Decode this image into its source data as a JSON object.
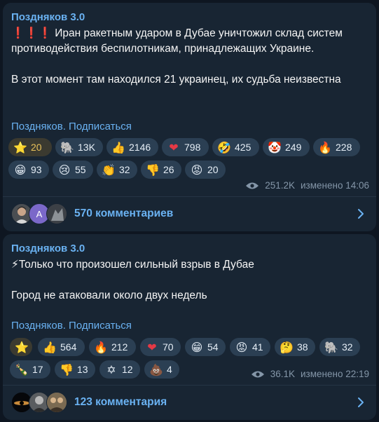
{
  "posts": [
    {
      "channel": "Поздняков 3.0",
      "text": "❗❗❗ Иран ракетным ударом в Дубае уничтожил склад систем противодействия беспилотникам, принадлежащих Украине.\n\nВ этот момент там находился 21 украинец, их судьба неизвестна",
      "subscribe": "Поздняков. Подписаться",
      "reactions": [
        {
          "icon": "star-icon",
          "emoji": "⭐",
          "count": "20"
        },
        {
          "icon": "elephant-icon",
          "emoji": "🐘",
          "count": "13K"
        },
        {
          "icon": "thumbs-up-icon",
          "emoji": "👍",
          "count": "2146"
        },
        {
          "icon": "heart-icon",
          "emoji": "❤",
          "count": "798"
        },
        {
          "icon": "rofl-icon",
          "emoji": "🤣",
          "count": "425"
        },
        {
          "icon": "clown-icon",
          "emoji": "🤡",
          "count": "249"
        },
        {
          "icon": "fire-icon",
          "emoji": "🔥",
          "count": "228"
        },
        {
          "icon": "grin-icon",
          "emoji": "😁",
          "count": "93"
        },
        {
          "icon": "cry-icon",
          "emoji": "😢",
          "count": "55"
        },
        {
          "icon": "clap-icon",
          "emoji": "👏",
          "count": "32"
        },
        {
          "icon": "thumbs-down-icon",
          "emoji": "👎",
          "count": "26"
        },
        {
          "icon": "angry-icon",
          "emoji": "😡",
          "count": "20"
        }
      ],
      "views": "251.2K",
      "edited": "изменено 14:06",
      "comments_label": "570 комментариев",
      "avatar_letter": "A"
    },
    {
      "channel": "Поздняков 3.0",
      "text": "⚡Только что произошел сильный взрыв в Дубае\n\nГород не атаковали около двух недель",
      "subscribe": "Поздняков. Подписаться",
      "reactions": [
        {
          "icon": "star-icon",
          "emoji": "⭐",
          "count": ""
        },
        {
          "icon": "thumbs-up-icon",
          "emoji": "👍",
          "count": "564"
        },
        {
          "icon": "fire-icon",
          "emoji": "🔥",
          "count": "212"
        },
        {
          "icon": "heart-icon",
          "emoji": "❤",
          "count": "70"
        },
        {
          "icon": "grin-icon",
          "emoji": "😁",
          "count": "54"
        },
        {
          "icon": "angry-icon",
          "emoji": "😡",
          "count": "41"
        },
        {
          "icon": "thinking-icon",
          "emoji": "🤔",
          "count": "38"
        },
        {
          "icon": "elephant-icon",
          "emoji": "🐘",
          "count": "32"
        },
        {
          "icon": "champagne-icon",
          "emoji": "🍾",
          "count": "17"
        },
        {
          "icon": "thumbs-down-icon",
          "emoji": "👎",
          "count": "13"
        },
        {
          "icon": "star-of-david-icon",
          "emoji": "✡",
          "count": "12"
        },
        {
          "icon": "poop-icon",
          "emoji": "💩",
          "count": "4"
        }
      ],
      "views": "36.1K",
      "edited": "изменено 22:19",
      "comments_label": "123 комментария"
    }
  ]
}
